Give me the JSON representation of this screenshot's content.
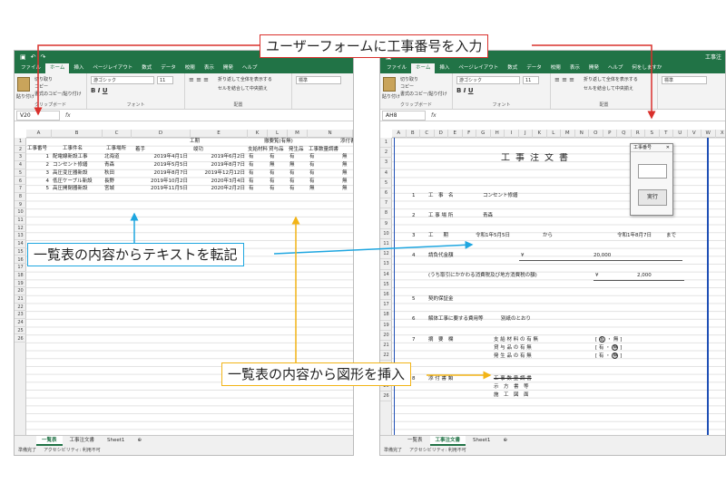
{
  "callouts": {
    "top": "ユーザーフォームに工事番号を入力",
    "middle": "一覧表の内容からテキストを転記",
    "bottom": "一覧表の内容から図形を挿入"
  },
  "left": {
    "tabs": [
      "ファイル",
      "ホーム",
      "挿入",
      "ページレイアウト",
      "数式",
      "データ",
      "校閲",
      "表示",
      "開発",
      "ヘルプ",
      "何をしますか"
    ],
    "ribbon": {
      "cut": "切り取り",
      "copy": "コピー",
      "painter": "書式のコピー/貼り付け",
      "paste": "貼り付け",
      "clipboard": "クリップボード",
      "font_name": "游ゴシック",
      "font_size": "11",
      "font": "フォント",
      "wrap": "折り返して全体を表示する",
      "merge": "セルを結合して中央揃え",
      "align": "配置",
      "numfmt": "標準"
    },
    "namebox": "V20",
    "fx": "fx",
    "columns": [
      "A",
      "B",
      "C",
      "D",
      "E",
      "K",
      "L",
      "M",
      "N"
    ],
    "rows": [
      "1",
      "2",
      "3",
      "4",
      "5",
      "6",
      "7",
      "8",
      "9",
      "10",
      "11",
      "12",
      "13",
      "14",
      "15",
      "16",
      "17",
      "18",
      "19",
      "20",
      "21",
      "22",
      "23",
      "24",
      "25",
      "26"
    ],
    "headers": {
      "no": "工事番号",
      "name": "工事件名",
      "place": "工事場所",
      "period": "工期",
      "start": "着手",
      "end": "竣功",
      "supply": "支給材料(有無)",
      "supply_short": "撤要覧(有無)",
      "c1": "支給材料",
      "c2": "貸与品",
      "c3": "発生品",
      "c4": "工事数量調書",
      "c5": "添付書類",
      "c6": "示"
    },
    "records": [
      {
        "no": "1",
        "name": "配電線新設工事",
        "place": "北海道",
        "start": "2019年4月1日",
        "end": "2019年6月2日",
        "c1": "有",
        "c2": "有",
        "c3": "有",
        "c4": "有",
        "c5": "無"
      },
      {
        "no": "2",
        "name": "コンセント修繕",
        "place": "青森",
        "start": "2019年5月5日",
        "end": "2019年8月7日",
        "c1": "有",
        "c2": "無",
        "c3": "無",
        "c4": "有",
        "c5": "無"
      },
      {
        "no": "3",
        "name": "高圧変圧器新設",
        "place": "秋田",
        "start": "2019年8月7日",
        "end": "2019年12月12日",
        "c1": "有",
        "c2": "有",
        "c3": "有",
        "c4": "有",
        "c5": "無"
      },
      {
        "no": "4",
        "name": "低圧ケーブル新設",
        "place": "長野",
        "start": "2019年10月2日",
        "end": "2020年3月4日",
        "c1": "有",
        "c2": "有",
        "c3": "有",
        "c4": "有",
        "c5": "無"
      },
      {
        "no": "5",
        "name": "高圧開閉器新設",
        "place": "宮城",
        "start": "2019年11月5日",
        "end": "2020年2月2日",
        "c1": "有",
        "c2": "有",
        "c3": "有",
        "c4": "無",
        "c5": "無"
      }
    ],
    "sheet_tabs": [
      "一覧表",
      "工事注文書",
      "Sheet1"
    ],
    "status": "準備完了",
    "accessibility": "アクセシビリティ: 利用不可"
  },
  "right": {
    "tabs": [
      "ファイル",
      "ホーム",
      "挿入",
      "ページレイアウト",
      "数式",
      "データ",
      "校閲",
      "表示",
      "開発",
      "ヘルプ",
      "何をしますか"
    ],
    "window_title": "工事注",
    "namebox": "AH8",
    "fx": "fx",
    "columns": [
      "A",
      "B",
      "C",
      "D",
      "E",
      "F",
      "G",
      "H",
      "I",
      "J",
      "K",
      "L",
      "M",
      "N",
      "O",
      "P",
      "Q",
      "R",
      "S",
      "T",
      "U",
      "V",
      "W",
      "X"
    ],
    "rows": [
      "1",
      "2",
      "3",
      "4",
      "5",
      "6",
      "7",
      "8",
      "9",
      "10",
      "11",
      "12",
      "13",
      "14",
      "15",
      "16",
      "17",
      "18",
      "19",
      "20",
      "21",
      "22",
      "23",
      "24",
      "25",
      "26"
    ],
    "doc": {
      "title": "工事注文書",
      "item1_no": "1",
      "item1_label": "工　事　名",
      "item1_value": "コンセント修繕",
      "item2_no": "2",
      "item2_label": "工 事 場 所",
      "item2_value": "青森",
      "item3_no": "3",
      "item3_label": "工　　期",
      "item3_from": "令和1年5月5日",
      "item3_mid": "から",
      "item3_to": "令和1年8月7日",
      "item3_end": "まで",
      "item4_no": "4",
      "item4_label": "請負代金額",
      "yen1": "¥",
      "amount": "20,000",
      "tax_note": "(うち取引にかかわる消費税及び地方消費税の額)",
      "yen2": "¥",
      "tax": "2,000",
      "item5_no": "5",
      "item5_label": "契約保証金",
      "item6_no": "6",
      "item6_label": "解体工事に要する費用等",
      "item6_value": "別紙のとおり",
      "item7_no": "7",
      "item7_label": "摘　要　欄",
      "m1": "支 給 材 料 の 有 無",
      "m2": "貸 与 品 の 有 無",
      "m3": "発 生 品 の 有 無",
      "yes": "有",
      "no": "無",
      "dot": "・",
      "item8_no": "8",
      "item8_label": "添 付 書 類",
      "att1": "工 事 数 量 調 書",
      "att2": "示　方　書　等",
      "att3": "施　工　図　面"
    },
    "dialog": {
      "title": "工事番号",
      "close": "✕",
      "button": "実行"
    },
    "sheet_tabs": [
      "一覧表",
      "工事注文書",
      "Sheet1"
    ],
    "status": "準備完了",
    "accessibility": "アクセシビリティ: 利用不可"
  },
  "colors": {
    "excel_green": "#217346",
    "red": "#d9302c",
    "blue": "#1ea6e0",
    "yellow": "#f2b417"
  }
}
